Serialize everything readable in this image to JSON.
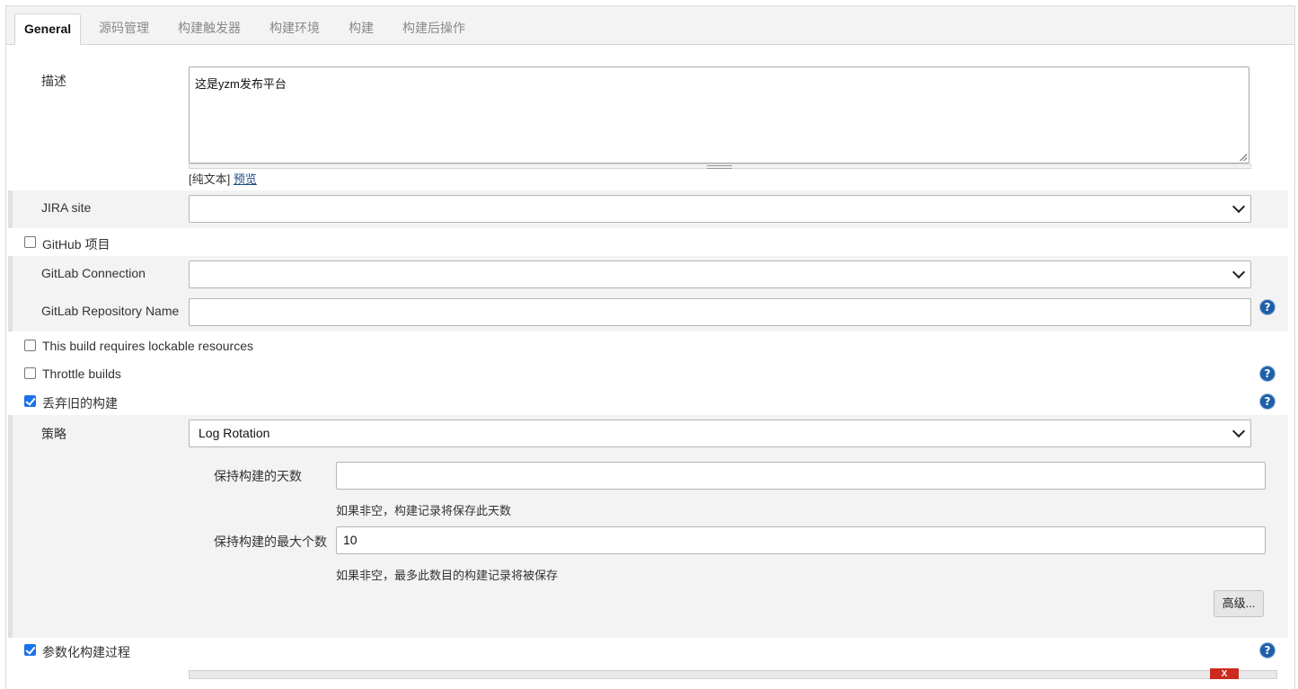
{
  "tabs": [
    {
      "label": "General"
    },
    {
      "label": "源码管理"
    },
    {
      "label": "构建触发器"
    },
    {
      "label": "构建环境"
    },
    {
      "label": "构建"
    },
    {
      "label": "构建后操作"
    }
  ],
  "description": {
    "label": "描述",
    "value": "这是yzm发布平台",
    "format_text": "[纯文本]",
    "preview_link": "预览"
  },
  "jira": {
    "label": "JIRA site",
    "value": ""
  },
  "github": {
    "label": "GitHub 项目",
    "checked": false
  },
  "gitlab": {
    "connection_label": "GitLab Connection",
    "connection_value": "",
    "repo_label": "GitLab Repository Name",
    "repo_value": ""
  },
  "lockable": {
    "label": "This build requires lockable resources",
    "checked": false
  },
  "throttle": {
    "label": "Throttle builds",
    "checked": false
  },
  "discard": {
    "label": "丢弃旧的构建",
    "checked": true,
    "strategy_label": "策略",
    "strategy_value": "Log Rotation",
    "days_label": "保持构建的天数",
    "days_value": "",
    "days_hint": "如果非空，构建记录将保存此天数",
    "max_label": "保持构建的最大个数",
    "max_value": "10",
    "max_hint": "如果非空，最多此数目的构建记录将被保存",
    "advanced_button": "高级..."
  },
  "parameterized": {
    "label": "参数化构建过程",
    "checked": true,
    "delete_label": "X"
  },
  "icons": {
    "help": "help-icon",
    "chevron": "chevron-down-icon",
    "checkbox": "checkbox"
  },
  "colors": {
    "accent": "#1a73e8",
    "help": "#1f5fa8",
    "section_bg": "#f3f3f3",
    "delete": "#cc2a1e"
  }
}
